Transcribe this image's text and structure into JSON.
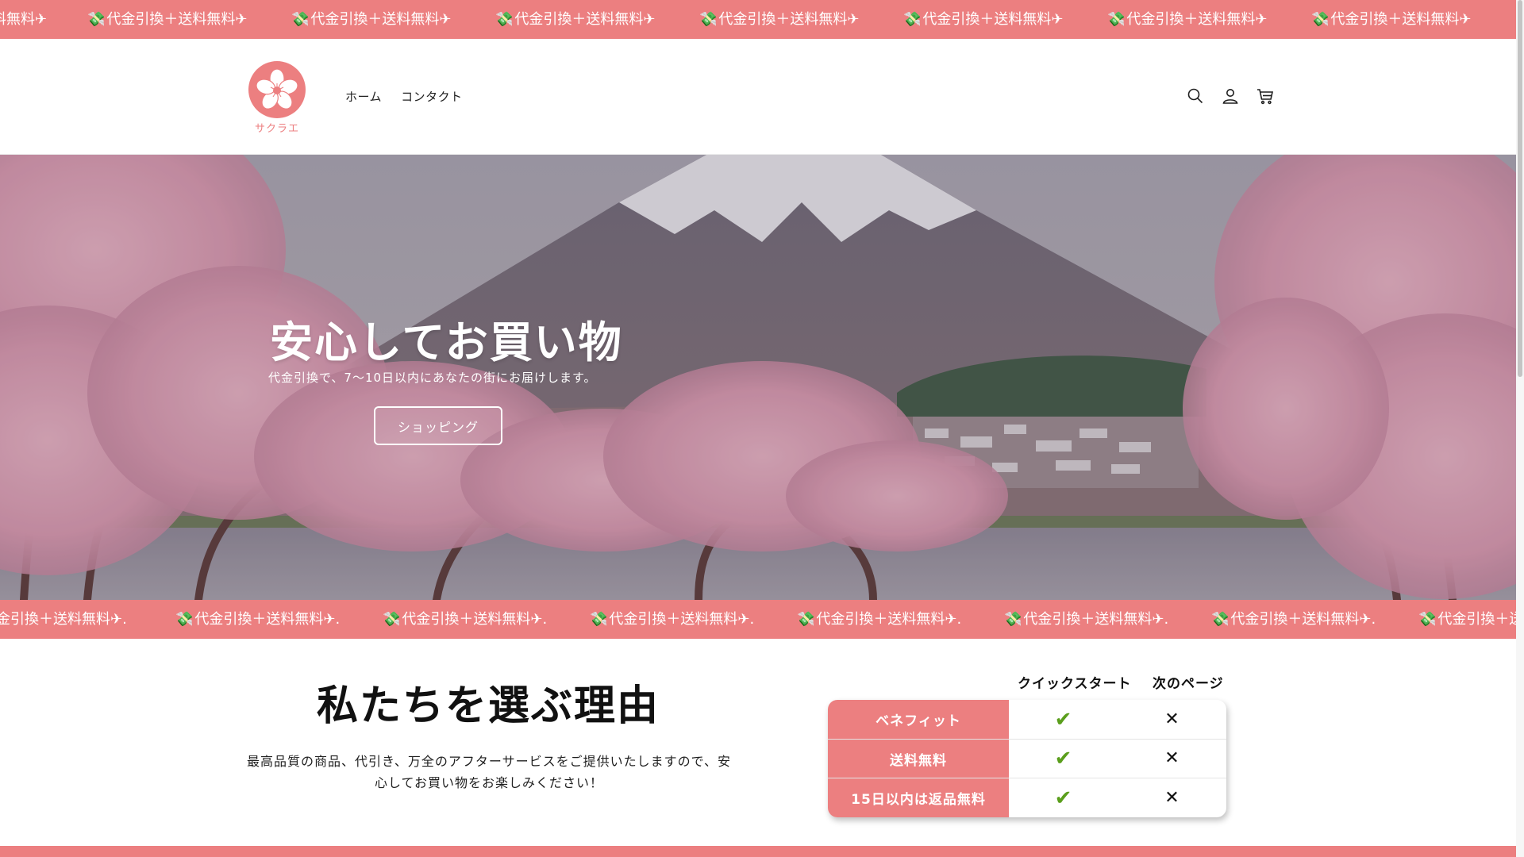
{
  "colors": {
    "brand_pink": "#ec7f80",
    "check_green": "#5a9e1c"
  },
  "announcement_top": {
    "text": "代金引換＋送料無料✈",
    "icon": "money-with-wings-icon",
    "partial_leading": "料無料✈"
  },
  "announcement_mid": {
    "text": "代金引換＋送料無料✈.",
    "icon": "money-with-wings-icon",
    "partial_leading": "金引換＋送料無料✈."
  },
  "header": {
    "logo_text": "サクラエ",
    "nav": [
      {
        "label": "ホーム"
      },
      {
        "label": "コンタクト"
      }
    ],
    "icons": [
      "search-icon",
      "account-icon",
      "cart-icon"
    ]
  },
  "hero": {
    "title": "安心してお買い物",
    "subtitle": "代金引換で、7〜10日以内にあなたの街にお届けします。",
    "button_label": "ショッピング"
  },
  "why": {
    "title": "私たちを選ぶ理由",
    "description": "最高品質の商品、代引き、万全のアフターサービスをご提供いたしますので、安心してお買い物をお楽しみください！"
  },
  "comparison": {
    "columns": [
      "クイックスタート",
      "次のページ"
    ],
    "rows": [
      {
        "label": "ベネフィット",
        "values": [
          true,
          false
        ]
      },
      {
        "label": "送料無料",
        "values": [
          true,
          false
        ]
      },
      {
        "label": "15日以内は返品無料",
        "values": [
          true,
          false
        ]
      }
    ]
  }
}
